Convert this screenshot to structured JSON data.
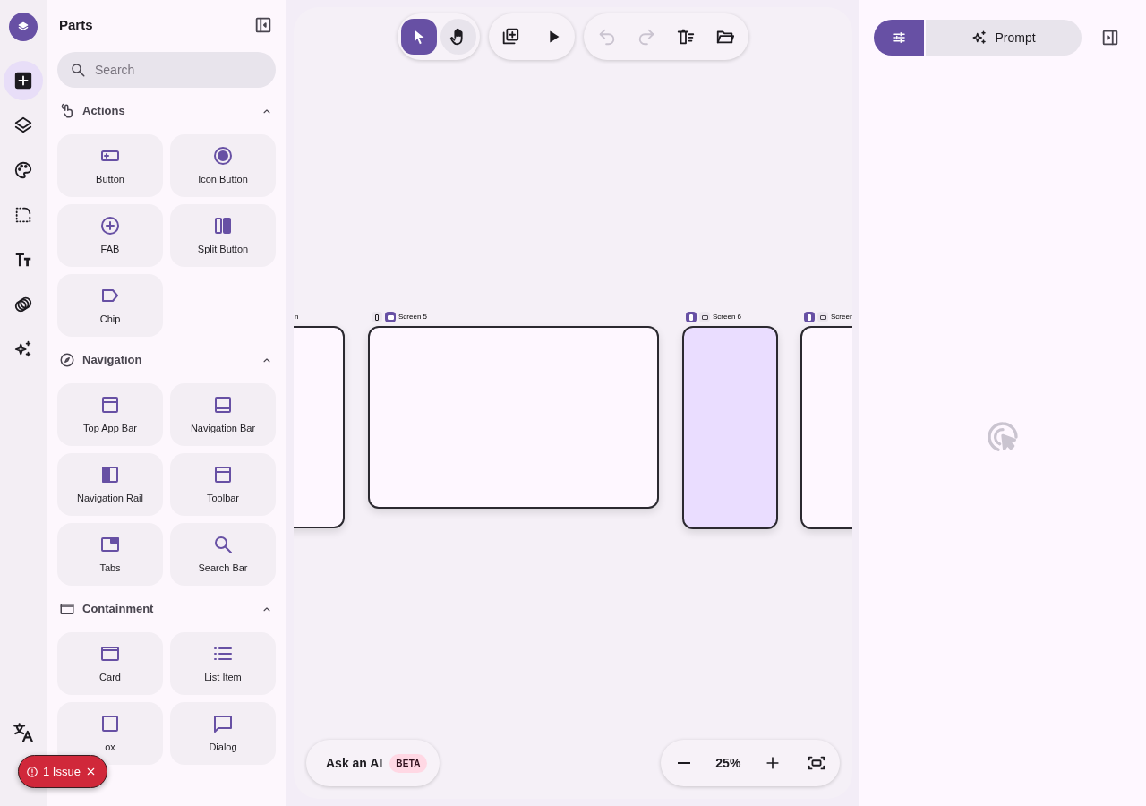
{
  "rail": {
    "items": [
      {
        "kind": "add",
        "selected": true
      },
      {
        "kind": "layers",
        "selected": false
      },
      {
        "kind": "palette",
        "selected": false
      },
      {
        "kind": "selection",
        "selected": false
      },
      {
        "kind": "text",
        "selected": false
      },
      {
        "kind": "circles",
        "selected": false
      },
      {
        "kind": "sparkles",
        "selected": false
      }
    ],
    "bottom": [
      {
        "kind": "translate"
      }
    ]
  },
  "parts": {
    "title": "Parts",
    "search": {
      "placeholder": "Search"
    },
    "sections": [
      {
        "kind": "actions",
        "title": "Actions",
        "expanded": true,
        "items": [
          {
            "kind": "button",
            "label": "Button"
          },
          {
            "kind": "icon-button",
            "label": "Icon Button"
          },
          {
            "kind": "fab",
            "label": "FAB"
          },
          {
            "kind": "split",
            "label": "Split Button"
          },
          {
            "kind": "chip",
            "label": "Chip"
          }
        ]
      },
      {
        "kind": "navigation",
        "title": "Navigation",
        "expanded": true,
        "items": [
          {
            "kind": "top-bar",
            "label": "Top App Bar"
          },
          {
            "kind": "bottom-bar",
            "label": "Navigation Bar"
          },
          {
            "kind": "rail",
            "label": "Navigation Rail"
          },
          {
            "kind": "top-bar",
            "label": "Toolbar"
          },
          {
            "kind": "tabs",
            "label": "Tabs"
          },
          {
            "kind": "search",
            "label": "Search Bar"
          }
        ]
      },
      {
        "kind": "containment",
        "title": "Containment",
        "expanded": true,
        "items": [
          {
            "kind": "card",
            "label": "Card"
          },
          {
            "kind": "list",
            "label": "List Item"
          },
          {
            "kind": "box",
            "label": "ox"
          },
          {
            "kind": "dialog",
            "label": "Dialog"
          }
        ]
      }
    ]
  },
  "toolbar": {
    "tools": [
      {
        "kind": "pointer",
        "selected": true
      },
      {
        "kind": "hand",
        "selected": false
      }
    ],
    "actions": [
      {
        "kind": "add-screen"
      },
      {
        "kind": "play"
      }
    ],
    "history": [
      {
        "kind": "undo",
        "disabled": true
      },
      {
        "kind": "redo",
        "disabled": true
      },
      {
        "kind": "delete",
        "disabled": false
      },
      {
        "kind": "folder",
        "disabled": false
      }
    ]
  },
  "canvas": {
    "screens": [
      {
        "label": "n",
        "selected": false
      },
      {
        "label": "Screen 5",
        "toggles": [
          {
            "kind": "phone",
            "selected": false
          },
          {
            "kind": "desktop",
            "selected": true
          }
        ],
        "selected": false
      },
      {
        "label": "Screen 6",
        "toggles": [
          {
            "kind": "phone",
            "selected": true
          },
          {
            "kind": "desktop",
            "selected": false
          }
        ],
        "selected": true
      },
      {
        "label": "Screen",
        "toggles": [
          {
            "kind": "phone",
            "selected": true
          },
          {
            "kind": "desktop",
            "selected": false
          }
        ],
        "selected": false
      }
    ]
  },
  "ask_ai": {
    "label": "Ask an AI",
    "badge": "BETA"
  },
  "zoom": {
    "value": "25%"
  },
  "issues": {
    "label": "1 Issue"
  },
  "right_panel": {
    "tabs": [
      {
        "kind": "tune",
        "selected": true
      },
      {
        "kind": "prompt",
        "label": "Prompt",
        "selected": false
      }
    ]
  }
}
